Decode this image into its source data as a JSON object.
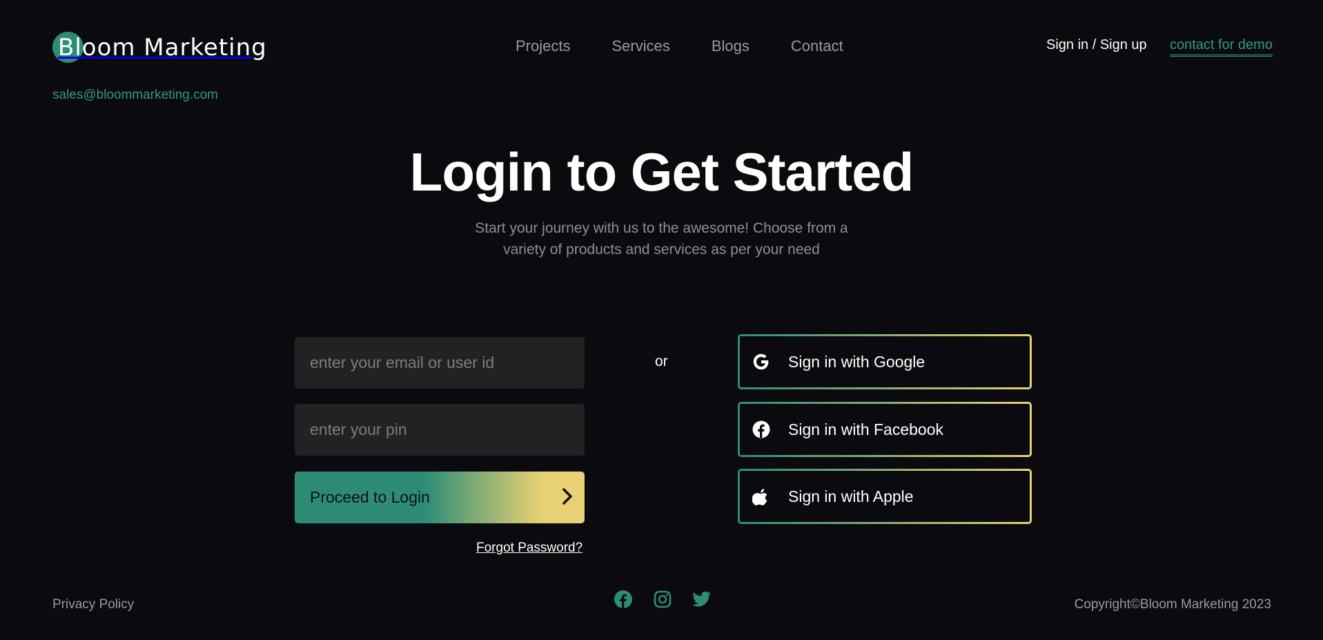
{
  "brand": {
    "logo_letter": "B",
    "logo_rest": "loom Marketing",
    "email": "sales@bloommarketing.com"
  },
  "nav": {
    "items": [
      {
        "label": "Projects"
      },
      {
        "label": "Services"
      },
      {
        "label": "Blogs"
      },
      {
        "label": "Contact"
      }
    ]
  },
  "header": {
    "signin_label": "Sign in / Sign up",
    "demo_label": "contact for demo"
  },
  "hero": {
    "title": "Login to Get Started",
    "subtitle_line1": "Start your journey with us to the awesome! Choose from a",
    "subtitle_line2": "variety of products and services as per your need"
  },
  "form": {
    "email_placeholder": "enter your email or user id",
    "pin_placeholder": "enter your pin",
    "proceed_label": "Proceed to Login",
    "forgot_label": "Forgot Password?",
    "or_label": "or"
  },
  "social_login": {
    "google_label": "Sign in with Google",
    "facebook_label": "Sign in with Facebook",
    "apple_label": "Sign in with Apple"
  },
  "footer": {
    "privacy_label": "Privacy Policy",
    "copyright": "Copyright©Bloom Marketing 2023",
    "social_icons": [
      "facebook-icon",
      "instagram-icon",
      "twitter-icon"
    ]
  },
  "colors": {
    "background": "#0b0b0f",
    "accent_green": "#2e8c76",
    "accent_gold": "#e8d174",
    "muted_text": "#9a9a9e"
  }
}
